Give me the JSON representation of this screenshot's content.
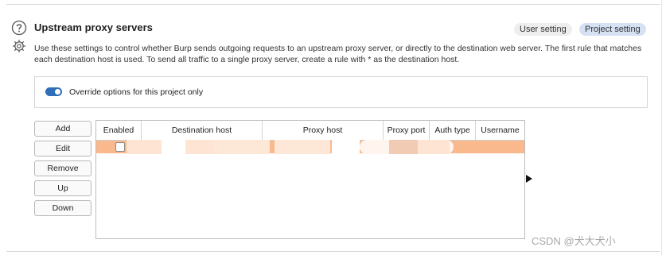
{
  "section": {
    "title": "Upstream proxy servers",
    "description": "Use these settings to  control whether Burp sends outgoing requests to an upstream proxy server, or directly to the destination web server. The first rule that matches each destination host is used. To send all traffic to a single proxy server, create a rule with * as the destination host.",
    "icons": {
      "help": "help-icon",
      "settings": "gear-icon"
    },
    "scope_tabs": [
      {
        "label": "User setting",
        "active": false
      },
      {
        "label": "Project setting",
        "active": true
      }
    ]
  },
  "override": {
    "label": "Override options for this project only",
    "enabled": true
  },
  "buttons": {
    "add": "Add",
    "edit": "Edit",
    "remove": "Remove",
    "up": "Up",
    "down": "Down"
  },
  "table": {
    "columns": [
      "Enabled",
      "Destination host",
      "Proxy host",
      "Proxy port",
      "Auth type",
      "Username"
    ],
    "rows": [
      {
        "enabled": false,
        "destination_host": "",
        "proxy_host": "",
        "proxy_port": "",
        "auth_type": "",
        "username": "",
        "selected": true
      }
    ]
  },
  "colors": {
    "accent": "#2f6fb8",
    "selected_row": "#f9b98c",
    "project_pill": "#d6e2f4",
    "user_pill": "#eeeeee"
  },
  "watermark": "CSDN @犬大犬小"
}
